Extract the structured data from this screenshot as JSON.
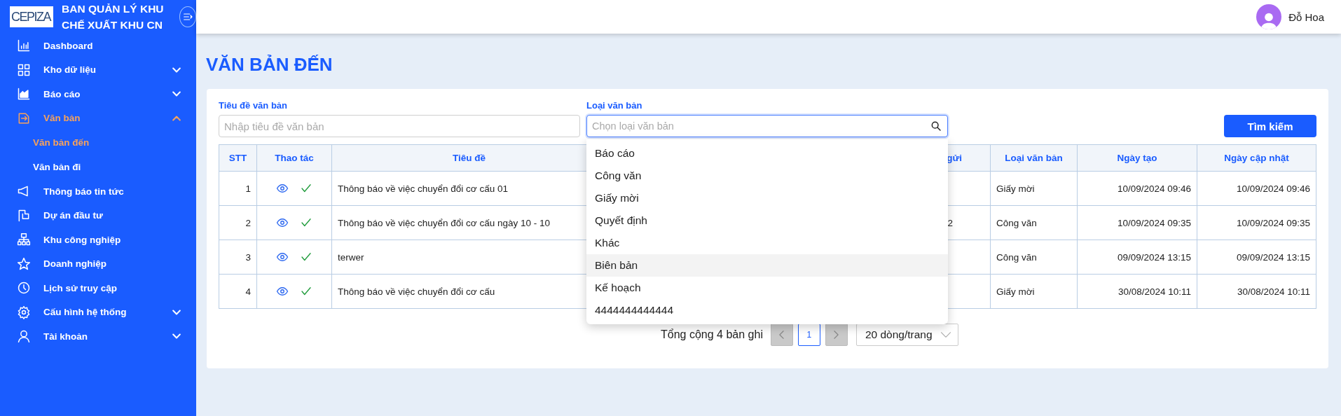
{
  "sidebar": {
    "logo_text": "CEPIZA",
    "title_lines": [
      "BAN QUẢN LÝ KHU",
      "CHẾ XUẤT KHU CN"
    ],
    "items": [
      {
        "label": "Dashboard",
        "selected": false
      },
      {
        "label": "Kho dữ liệu",
        "selected": false,
        "expanded": false
      },
      {
        "label": "Báo cáo",
        "selected": false,
        "expanded": false
      },
      {
        "label": "Văn bản",
        "selected": true,
        "expanded": true,
        "children": [
          {
            "label": "Văn bản đến",
            "selected": true
          },
          {
            "label": "Văn bản đi",
            "selected": false
          }
        ]
      },
      {
        "label": "Thông báo tin tức",
        "selected": false
      },
      {
        "label": "Dự án đầu tư",
        "selected": false
      },
      {
        "label": "Khu công nghiệp",
        "selected": false
      },
      {
        "label": "Doanh nghiệp",
        "selected": false
      },
      {
        "label": "Lịch sử truy cập",
        "selected": false
      },
      {
        "label": "Cấu hình hệ thống",
        "selected": false,
        "expanded": false
      },
      {
        "label": "Tài khoản",
        "selected": false,
        "expanded": false
      }
    ]
  },
  "header": {
    "user_name": "Đỗ Hoa"
  },
  "page_title": "VĂN BẢN ĐẾN",
  "filters": {
    "title_field": {
      "label": "Tiêu đề văn bản",
      "placeholder": "Nhập tiêu đề văn bản"
    },
    "type_field": {
      "label": "Loại văn bản",
      "placeholder": "Chọn loại văn bản"
    },
    "search_button": "Tìm kiếm"
  },
  "dropdown": {
    "options": [
      {
        "label": "Báo cáo",
        "highlighted": false
      },
      {
        "label": "Công văn",
        "highlighted": false
      },
      {
        "label": "Giấy mời",
        "highlighted": false
      },
      {
        "label": "Quyết định",
        "highlighted": false
      },
      {
        "label": "Khác",
        "highlighted": false
      },
      {
        "label": "Biên bản",
        "highlighted": true
      },
      {
        "label": "Kế hoạch",
        "highlighted": false
      },
      {
        "label": "4444444444444",
        "highlighted": false
      }
    ]
  },
  "table": {
    "columns": [
      "STT",
      "Thao tác",
      "Tiêu đề",
      "gửi",
      "Loại văn bản",
      "Ngày tạo",
      "Ngày cập nhật"
    ],
    "rows": [
      {
        "stt": "1",
        "title": "Thông báo về việc chuyển đổi cơ cấu 01",
        "type": "Giấy mời",
        "created": "10/09/2024 09:46",
        "updated": "10/09/2024 09:46"
      },
      {
        "stt": "2",
        "title": "Thông báo về việc chuyển đổi cơ cấu ngày 10 - 10",
        "column_4": "2",
        "type": "Công văn",
        "created": "10/09/2024 09:35",
        "updated": "10/09/2024 09:35"
      },
      {
        "stt": "3",
        "title": "terwer",
        "type": "Công văn",
        "created": "09/09/2024 13:15",
        "updated": "09/09/2024 13:15"
      },
      {
        "stt": "4",
        "title": "Thông báo về việc chuyển đổi cơ cấu",
        "type": "Giấy mời",
        "created": "30/08/2024 10:11",
        "updated": "30/08/2024 10:11"
      }
    ]
  },
  "pagination": {
    "total": "Tổng cộng 4 bản ghi",
    "prev_disabled": true,
    "pages": [
      {
        "label": "1",
        "selected": true
      }
    ],
    "next_disabled": true,
    "page_size": "20 dòng/trang"
  }
}
